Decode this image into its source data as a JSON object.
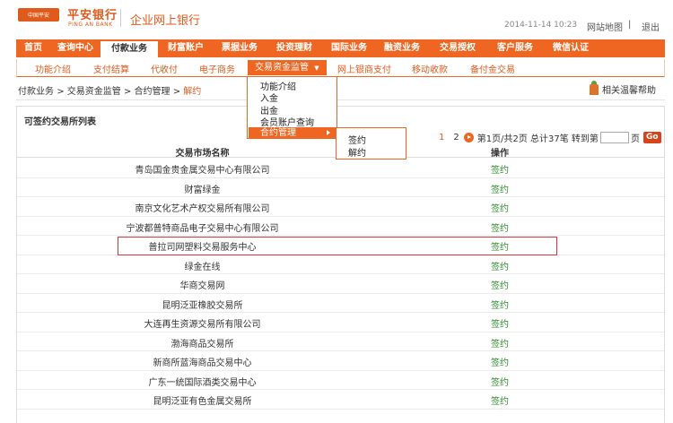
{
  "header": {
    "logo_badge": "中国平安",
    "logo_cn": "平安银行",
    "logo_en": "PING AN BANK",
    "title": "企业网上银行",
    "datetime": "2014-11-14  10:23",
    "sitemap": "网站地图",
    "separator": "|",
    "logout": "退出"
  },
  "main_nav": [
    "首页",
    "查询中心",
    "付款业务",
    "财富账户",
    "票据业务",
    "投资理财",
    "国际业务",
    "融资业务",
    "交易授权",
    "客户服务",
    "微信认证"
  ],
  "sub_nav": [
    "功能介绍",
    "支付结算",
    "代收付",
    "电子商务",
    "交易资金监管",
    "网上银商支付",
    "移动收款",
    "备付金交易"
  ],
  "breadcrumb": {
    "parts": [
      "付款业务",
      "交易资金监管",
      "合约管理"
    ],
    "current": "解约",
    "sep": ">"
  },
  "help": "相关温馨帮助",
  "panel": {
    "title": "可签约交易所列表",
    "pager": {
      "page1": "1",
      "page2": "2",
      "info": "第1页/共2页  总计37笔  转到第",
      "suffix": "页",
      "go": "Go"
    },
    "col_name": "交易市场名称",
    "col_op": "操作",
    "rows": [
      {
        "name": "青岛国金贵金属交易中心有限公司",
        "op": "签约"
      },
      {
        "name": "财富绿金",
        "op": "签约"
      },
      {
        "name": "南京文化艺术产权交易所有限公司",
        "op": "签约"
      },
      {
        "name": "宁波都普特商品电子交易中心有限公司",
        "op": "签约"
      },
      {
        "name": "普拉司网塑料交易服务中心",
        "op": "签约"
      },
      {
        "name": "绿金在线",
        "op": "签约"
      },
      {
        "name": "华商交易网",
        "op": "签约"
      },
      {
        "name": "昆明泛亚橡胶交易所",
        "op": "签约"
      },
      {
        "name": "大连再生资源交易所有限公司",
        "op": "签约"
      },
      {
        "name": "渤海商品交易所",
        "op": "签约"
      },
      {
        "name": "新商所蓝海商品交易中心",
        "op": "签约"
      },
      {
        "name": "广东一统国际酒类交易中心",
        "op": "签约"
      },
      {
        "name": "昆明泛亚有色金属交易所",
        "op": "签约"
      }
    ]
  },
  "dropdown": [
    "功能介绍",
    "入金",
    "出金",
    "会员账户查询",
    "合约管理"
  ],
  "flyout": [
    "签约",
    "解约"
  ]
}
